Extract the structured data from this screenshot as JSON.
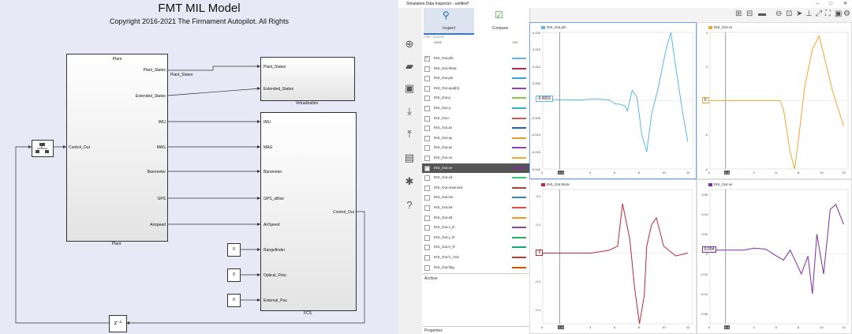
{
  "simulink": {
    "title": "FMT MIL Model",
    "copyright": "Copyright 2016-2021 The Firmament Autopilot. All Rights",
    "plant": {
      "header": "Plant",
      "caption": "Plant",
      "ports_out": [
        "Plant_States",
        "Extended_States",
        "IMU",
        "MAG",
        "Barometer",
        "GPS",
        "Airspeed"
      ],
      "port_in": "Control_Out"
    },
    "wire_label": "Plant_States",
    "virtualization": {
      "caption": "Virtualization",
      "ports_in": [
        "Plant_States",
        "Extended_States"
      ]
    },
    "fcs": {
      "caption": "FCS",
      "ports_in": [
        "IMU",
        "MAG",
        "Barometer",
        "GPS_uBlox",
        "AirSpeed",
        "Rangefinder",
        "Optical_Flow",
        "External_Pos"
      ],
      "port_out": "Control_Out"
    },
    "constants": [
      "0",
      "0",
      "0"
    ],
    "delay_label": "z⁻¹"
  },
  "sdi": {
    "window_title": "Simulation Data Inspector - untitled*",
    "window_controls": [
      "–",
      "□",
      "✕"
    ],
    "tabs": {
      "inspect": "Inspect",
      "compare": "Compare"
    },
    "filter_placeholder": "Filter Signals",
    "col_name": "NAME",
    "col_line": "LINE",
    "signals": [
      {
        "name": "INS_Out.phi",
        "color": "#5ab7e8",
        "checked": true
      },
      {
        "name": "INS_Out.theta",
        "color": "#b8283c",
        "checked": false
      },
      {
        "name": "INS_Out.psi",
        "color": "#3aa0e0",
        "checked": false
      },
      {
        "name": "INS_Out.quat[1]",
        "color": "#9b3cb8",
        "checked": false
      },
      {
        "name": "INS_Out.p",
        "color": "#8bc34a",
        "checked": false
      },
      {
        "name": "INS_Out.q",
        "color": "#29b6c8",
        "checked": false
      },
      {
        "name": "INS_Out.r",
        "color": "#d9534f",
        "checked": false
      },
      {
        "name": "INS_Out.ax",
        "color": "#1f5fbf",
        "checked": false
      },
      {
        "name": "INS_Out.ay",
        "color": "#e89a2c",
        "checked": false
      },
      {
        "name": "INS_Out.az",
        "color": "#8e44ad",
        "checked": false
      },
      {
        "name": "INS_Out.vn",
        "color": "#f0a830",
        "checked": false
      },
      {
        "name": "INS_Out.ve",
        "color": "#7b2e9a",
        "checked": true,
        "selected": true
      },
      {
        "name": "INS_Out.vd",
        "color": "#2ecc71",
        "checked": false
      },
      {
        "name": "INS_Out.reserved",
        "color": "#c0392b",
        "checked": false
      },
      {
        "name": "INS_Out.lon",
        "color": "#2e86c1",
        "checked": false
      },
      {
        "name": "INS_Out.lat",
        "color": "#e74c3c",
        "checked": false
      },
      {
        "name": "INS_Out.alt",
        "color": "#f39c12",
        "checked": false
      },
      {
        "name": "INS_Out.x_R",
        "color": "#8e44ad",
        "checked": false
      },
      {
        "name": "INS_Out.y_R",
        "color": "#27ae60",
        "checked": false
      },
      {
        "name": "INS_Out.h_R",
        "color": "#16a085",
        "checked": false
      },
      {
        "name": "INS_Out.h_AGL",
        "color": "#c0392b",
        "checked": false
      },
      {
        "name": "INS_Out.flag",
        "color": "#d35400",
        "checked": false
      }
    ],
    "archive_label": "Archive",
    "properties_label": "Properties",
    "plots": [
      {
        "title": "INS_Out.phi",
        "color": "#5ab7e8",
        "cursor_value": "0.0003",
        "yticks": [
          "0.020",
          "0.015",
          "0.010",
          "0.005",
          "0",
          "-0.005",
          "-0.010",
          "-0.015",
          "-0.020"
        ],
        "xticks": [
          "0",
          "1.4",
          "4",
          "6",
          "8",
          "10",
          "12"
        ],
        "active": true
      },
      {
        "title": "INS_Out.vn",
        "color": "#f0a830",
        "cursor_value": "0",
        "yticks": [
          "4",
          "2",
          "0",
          "-2",
          "-4"
        ],
        "xticks": [
          "0",
          "1.4",
          "4",
          "6",
          "8",
          "10",
          "12"
        ],
        "active": false
      },
      {
        "title": "INS_Out.theta",
        "color": "#b8283c",
        "cursor_value": "0",
        "yticks": [
          "0.4",
          "0.2",
          "0",
          "-0.2",
          "-0.4"
        ],
        "xticks": [
          "0",
          "1.4",
          "4",
          "6",
          "8",
          "10",
          "12"
        ],
        "active": false
      },
      {
        "title": "INS_Out.ve",
        "color": "#7b2e9a",
        "cursor_value": "0.004",
        "yticks": [
          "0.06",
          "0.04",
          "0.02",
          "0",
          "-0.02",
          "-0.04",
          "-0.06"
        ],
        "xticks": [
          "0",
          "1.4",
          "4",
          "6",
          "8",
          "10",
          "12"
        ],
        "active": false
      }
    ],
    "cursor_time": "1.4",
    "series": {
      "phi": [
        [
          0,
          0.0003
        ],
        [
          1.4,
          0.0003
        ],
        [
          3,
          0.0002
        ],
        [
          4.3,
          0.0005
        ],
        [
          5.5,
          0.0002
        ],
        [
          6,
          -0.001
        ],
        [
          6.3,
          -0.001
        ],
        [
          6.8,
          -0.0015
        ],
        [
          7,
          -0.003
        ],
        [
          7.4,
          0.003
        ],
        [
          7.8,
          0.001
        ],
        [
          8.2,
          -0.01
        ],
        [
          8.6,
          -0.015
        ],
        [
          9.0,
          -0.004
        ],
        [
          9.5,
          0.003
        ],
        [
          10.2,
          0.015
        ],
        [
          10.6,
          0.02
        ],
        [
          11.0,
          0.01
        ],
        [
          11.6,
          -0.004
        ],
        [
          12,
          -0.012
        ]
      ],
      "vn": [
        [
          0,
          0
        ],
        [
          1.4,
          0
        ],
        [
          3,
          0
        ],
        [
          6.3,
          0
        ],
        [
          6.6,
          -0.5
        ],
        [
          7.2,
          -3
        ],
        [
          7.6,
          -4
        ],
        [
          8.0,
          -2
        ],
        [
          8.5,
          0.8
        ],
        [
          9.2,
          3
        ],
        [
          9.8,
          3.8
        ],
        [
          10.4,
          2.2
        ],
        [
          11.0,
          0.6
        ],
        [
          12,
          -1.5
        ]
      ],
      "theta": [
        [
          0,
          0
        ],
        [
          1.4,
          0
        ],
        [
          4,
          0
        ],
        [
          5.5,
          0.02
        ],
        [
          6.2,
          0.05
        ],
        [
          6.6,
          0.35
        ],
        [
          7.2,
          0.1
        ],
        [
          7.6,
          -0.25
        ],
        [
          8.0,
          -0.5
        ],
        [
          8.4,
          -0.3
        ],
        [
          8.6,
          0.05
        ],
        [
          9.0,
          0.2
        ],
        [
          9.4,
          0.25
        ],
        [
          10,
          0.05
        ],
        [
          11,
          -0.02
        ],
        [
          12,
          0
        ]
      ],
      "ve": [
        [
          0,
          0.004
        ],
        [
          1.4,
          0.004
        ],
        [
          3,
          0.004
        ],
        [
          4,
          0.006
        ],
        [
          5,
          0.005
        ],
        [
          6,
          -0.002
        ],
        [
          6.6,
          -0.006
        ],
        [
          7.2,
          0.004
        ],
        [
          7.8,
          -0.01
        ],
        [
          8.2,
          -0.02
        ],
        [
          8.8,
          -0.002
        ],
        [
          9.2,
          -0.04
        ],
        [
          9.6,
          0.02
        ],
        [
          10.2,
          -0.02
        ],
        [
          10.8,
          0.045
        ],
        [
          11.3,
          0.05
        ],
        [
          12,
          0.03
        ]
      ]
    }
  }
}
